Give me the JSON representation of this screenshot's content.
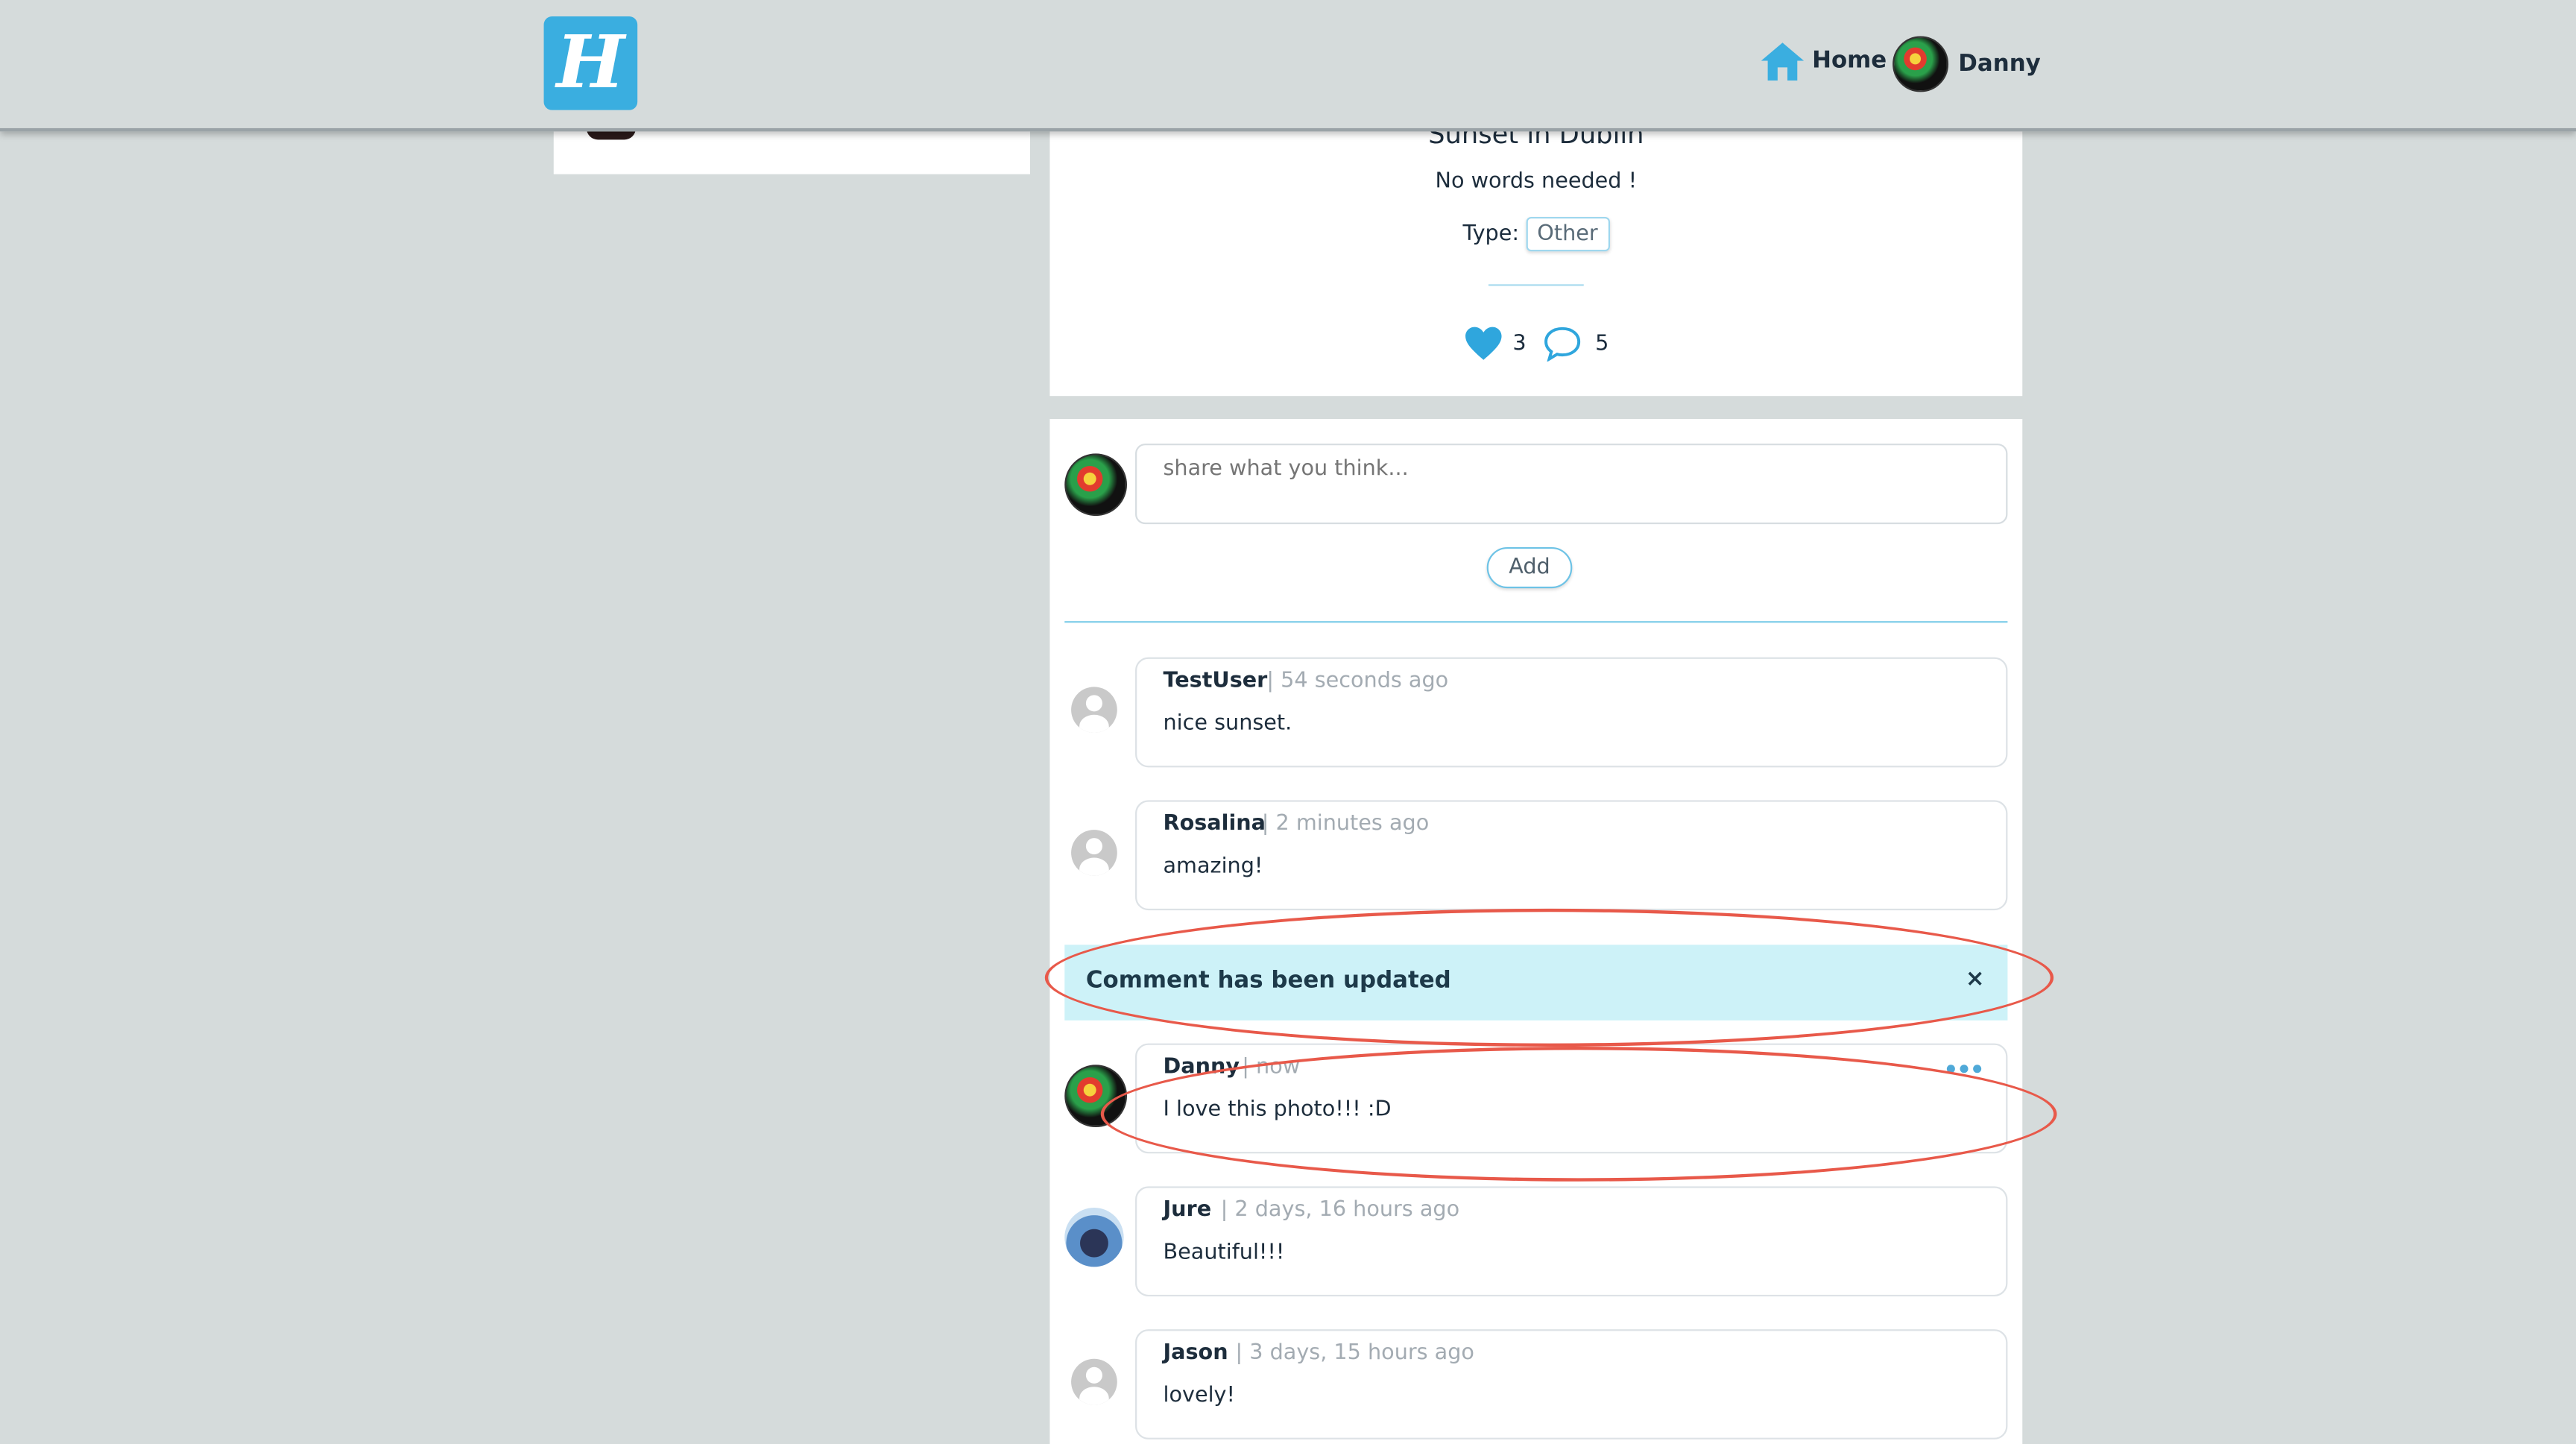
{
  "nav": {
    "logo_letter": "H",
    "home_label": "Home",
    "user_name": "Danny"
  },
  "post": {
    "title": "Sunset in Dublin",
    "description": "No words needed !",
    "type_label": "Type:",
    "type_value": "Other",
    "likes": "3",
    "comments": "5"
  },
  "new_comment": {
    "placeholder": "share what you think...",
    "add_label": "Add"
  },
  "alert": {
    "message": "Comment has been updated",
    "close": "×"
  },
  "comments": [
    {
      "author": "TestUser",
      "time": "| 54 seconds ago",
      "text": "nice sunset."
    },
    {
      "author": "Rosalina",
      "time": "| 2 minutes ago",
      "text": "amazing!"
    },
    {
      "author": "Danny",
      "time": "| now",
      "text": "I love this photo!!! :D"
    },
    {
      "author": "Jure",
      "time": "| 2 days, 16 hours ago",
      "text": "Beautiful!!!"
    },
    {
      "author": "Jason",
      "time": "| 3 days, 15 hours ago",
      "text": "lovely!"
    }
  ],
  "colors": {
    "accent": "#3aaee0",
    "annotation": "#e8594a",
    "alert_bg": "#cdf2f8"
  }
}
